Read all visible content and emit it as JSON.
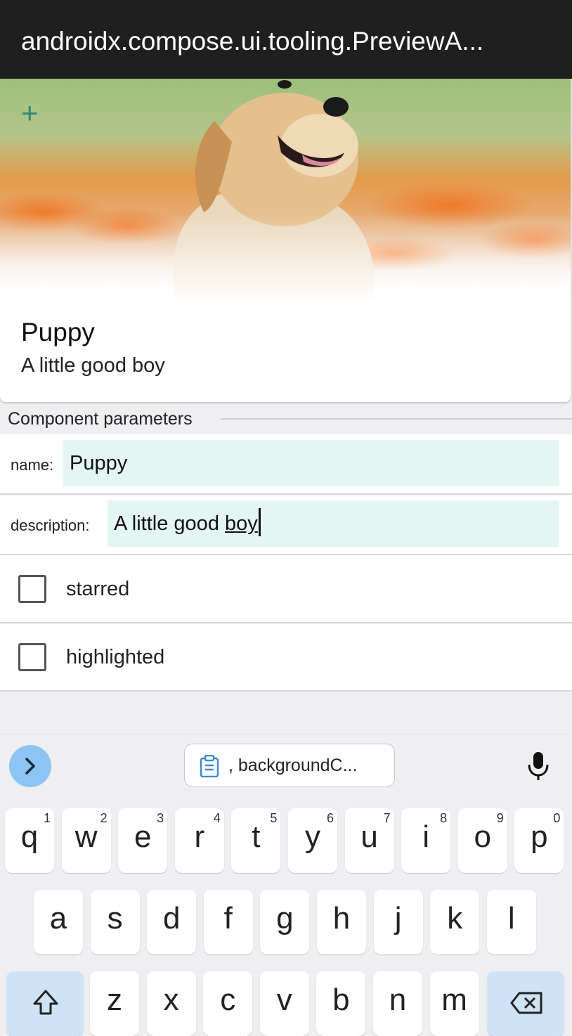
{
  "window": {
    "title": "androidx.compose.ui.tooling.PreviewA..."
  },
  "card": {
    "name": "Puppy",
    "description": "A little good boy"
  },
  "params": {
    "section_title": "Component parameters",
    "name_label": "name:",
    "name_value": "Puppy",
    "description_label": "description:",
    "description_value_prefix": "A little good ",
    "description_value_underlined": "boy",
    "starred_label": "starred",
    "highlighted_label": "highlighted"
  },
  "keyboard": {
    "clipboard_suggestion": ", backgroundC...",
    "row1": [
      {
        "key": "q",
        "hint": "1"
      },
      {
        "key": "w",
        "hint": "2"
      },
      {
        "key": "e",
        "hint": "3"
      },
      {
        "key": "r",
        "hint": "4"
      },
      {
        "key": "t",
        "hint": "5"
      },
      {
        "key": "y",
        "hint": "6"
      },
      {
        "key": "u",
        "hint": "7"
      },
      {
        "key": "i",
        "hint": "8"
      },
      {
        "key": "o",
        "hint": "9"
      },
      {
        "key": "p",
        "hint": "0"
      }
    ],
    "row2": [
      "a",
      "s",
      "d",
      "f",
      "g",
      "h",
      "j",
      "k",
      "l"
    ],
    "row3": [
      "z",
      "x",
      "c",
      "v",
      "b",
      "n",
      "m"
    ]
  },
  "colors": {
    "accent": "#2e8a7c",
    "input_bg": "#e3f6f4",
    "title_bar": "#1f1f1f"
  }
}
